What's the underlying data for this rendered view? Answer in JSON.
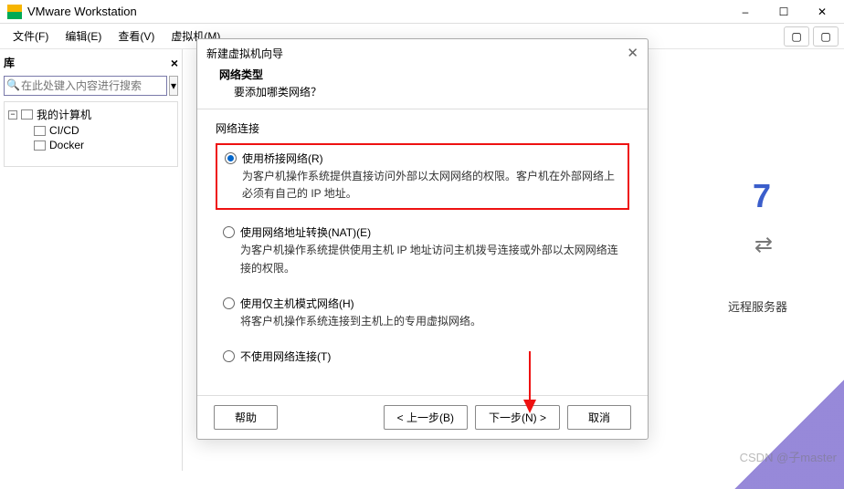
{
  "window": {
    "title": "VMware Workstation"
  },
  "menu": {
    "file": "文件(F)",
    "edit": "编辑(E)",
    "view": "查看(V)",
    "vm": "虚拟机(M)"
  },
  "sidebar": {
    "title": "库",
    "search_placeholder": "在此处键入内容进行搜索",
    "tree": {
      "root": "我的计算机",
      "items": [
        "CI/CD",
        "Docker"
      ]
    }
  },
  "background": {
    "num": "7",
    "swap": "⇄",
    "remote": "远程服务器"
  },
  "dialog": {
    "title": "新建虚拟机向导",
    "heading": "网络类型",
    "sub": "要添加哪类网络？",
    "group": "网络连接",
    "options": [
      {
        "label": "使用桥接网络(R)",
        "desc": "为客户机操作系统提供直接访问外部以太网网络的权限。客户机在外部网络上必须有自己的 IP 地址。",
        "checked": true,
        "highlight": true
      },
      {
        "label": "使用网络地址转换(NAT)(E)",
        "desc": "为客户机操作系统提供使用主机 IP 地址访问主机拨号连接或外部以太网网络连接的权限。",
        "checked": false,
        "highlight": false
      },
      {
        "label": "使用仅主机模式网络(H)",
        "desc": "将客户机操作系统连接到主机上的专用虚拟网络。",
        "checked": false,
        "highlight": false
      },
      {
        "label": "不使用网络连接(T)",
        "desc": "",
        "checked": false,
        "highlight": false
      }
    ],
    "buttons": {
      "help": "帮助",
      "back": "< 上一步(B)",
      "next": "下一步(N) >",
      "cancel": "取消"
    }
  },
  "watermark": "CSDN @子master"
}
